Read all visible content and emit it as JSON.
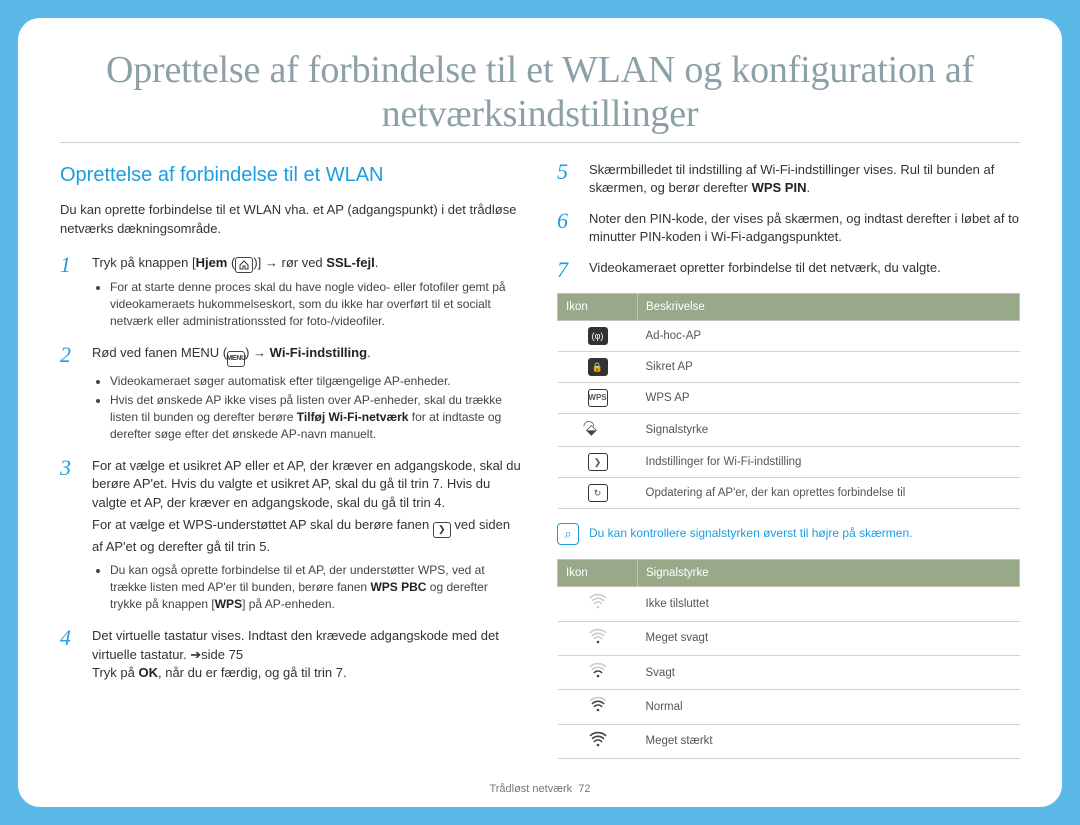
{
  "title": "Oprettelse af forbindelse til et WLAN og konfiguration af netværksindstillinger",
  "section_heading": "Oprettelse af forbindelse til et WLAN",
  "intro": "Du kan oprette forbindelse til et WLAN vha. et AP (adgangspunkt) i det trådløse netværks dækningsområde.",
  "steps": {
    "s1": {
      "pre": "Tryk på knappen [",
      "bold1": "Hjem",
      "mid1": " (",
      "mid2": ")] → rør ved ",
      "bold2": "SSL-fejl",
      "post": ".",
      "bullets": [
        "For at starte denne proces skal du have nogle video- eller fotofiler gemt på videokameraets hukommelseskort, som du ikke har overført til et socialt netværk eller administrationssted for foto-/videofiler."
      ]
    },
    "s2": {
      "pre": "Rød ved fanen MENU (",
      "mid": ") → ",
      "bold": "Wi-Fi-indstilling",
      "post": ".",
      "bullets_pre": "Videokameraet søger automatisk efter tilgængelige AP-enheder.",
      "bullets_b_pre": "Hvis det ønskede AP ikke vises på listen over AP-enheder, skal du trække listen til bunden og derefter berøre ",
      "bullets_b_bold": "Tilføj Wi-Fi-netværk",
      "bullets_b_post": " for at indtaste og derefter søge efter det ønskede AP-navn manuelt."
    },
    "s3": {
      "p1": "For at vælge et usikret AP eller et AP, der kræver en adgangskode, skal du berøre AP'et. Hvis du valgte et usikret AP, skal du gå til trin 7. Hvis du valgte et AP, der kræver en adgangskode, skal du gå til trin 4.",
      "p2_pre": "For at vælge et WPS-understøttet AP skal du berøre fanen ",
      "p2_post": " ved siden af AP'et og derefter gå til trin 5.",
      "bul_pre": "Du kan også oprette forbindelse til et AP, der understøtter WPS, ved at trække listen med AP'er til bunden, berøre fanen ",
      "bul_b1": "WPS PBC",
      "bul_mid": " og derefter trykke på knappen [",
      "bul_b2": "WPS",
      "bul_post": "] på AP-enheden."
    },
    "s4": {
      "p_pre": "Det virtuelle tastatur vises. Indtast den krævede adgangskode med det virtuelle tastatur. ➔side 75",
      "p2_pre": "Tryk på ",
      "p2_b": "OK",
      "p2_post": ", når du er færdig, og gå til trin 7."
    },
    "s5": {
      "pre": "Skærmbilledet til indstilling af Wi-Fi-indstillinger vises. Rul til bunden af skærmen, og berør derefter ",
      "bold": "WPS PIN",
      "post": "."
    },
    "s6": "Noter den PIN-kode, der vises på skærmen, og indtast derefter i løbet af to minutter PIN-koden i Wi-Fi-adgangspunktet.",
    "s7": "Videokameraet opretter forbindelse til det netværk, du valgte."
  },
  "table1": {
    "headers": [
      "Ikon",
      "Beskrivelse"
    ],
    "rows": [
      {
        "icon": "adhoc",
        "desc": "Ad-hoc-AP"
      },
      {
        "icon": "lock",
        "desc": "Sikret AP"
      },
      {
        "icon": "wps",
        "desc": "WPS AP"
      },
      {
        "icon": "wifi",
        "desc": "Signalstyrke"
      },
      {
        "icon": "chevron",
        "desc": "Indstillinger for Wi-Fi-indstilling"
      },
      {
        "icon": "refresh",
        "desc": "Opdatering af AP'er, der kan oprettes forbindelse til"
      }
    ]
  },
  "note": "Du kan kontrollere signalstyrken øverst til højre på skærmen.",
  "table2": {
    "headers": [
      "Ikon",
      "Signalstyrke"
    ],
    "rows": [
      {
        "level": 0,
        "desc": "Ikke tilsluttet"
      },
      {
        "level": 1,
        "desc": "Meget svagt"
      },
      {
        "level": 2,
        "desc": "Svagt"
      },
      {
        "level": 3,
        "desc": "Normal"
      },
      {
        "level": 4,
        "desc": "Meget stærkt"
      }
    ]
  },
  "footer": {
    "section": "Trådløst netværk",
    "page": "72"
  }
}
